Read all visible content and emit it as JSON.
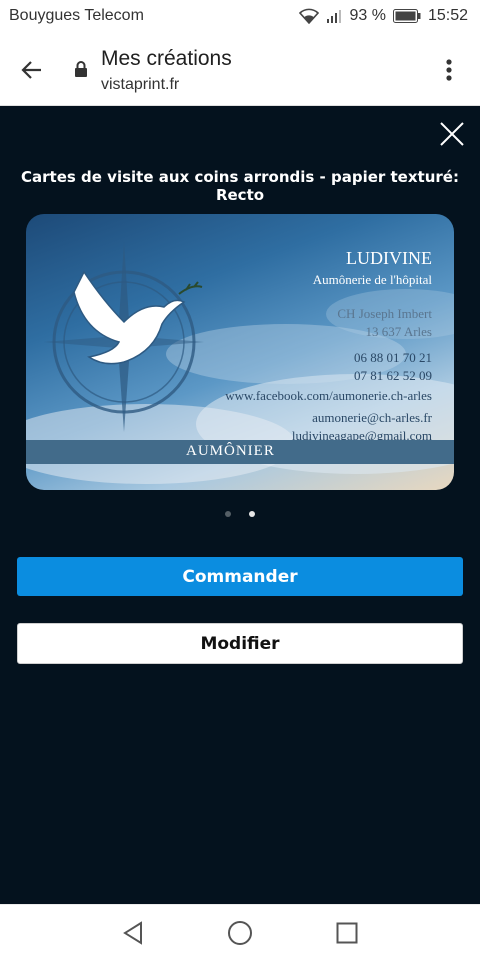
{
  "status_bar": {
    "carrier": "Bouygues Telecom",
    "battery": "93 %",
    "time": "15:52"
  },
  "browser": {
    "title": "Mes créations",
    "url": "vistaprint.fr"
  },
  "viewer": {
    "heading": "Cartes de visite aux coins arrondis - papier texturé: Recto",
    "card": {
      "name": "LUDIVINE",
      "subtitle": "Aumônerie de l'hôpital",
      "address_line1": "CH Joseph Imbert",
      "address_line2": "13 637 Arles",
      "phone1": "06 88 01 70 21",
      "phone2": "07 81 62 52 09",
      "website": "www.facebook.com/aumonerie.ch-arles",
      "email1": "aumonerie@ch-arles.fr",
      "email2": "ludivineagape@gmail.com",
      "band_label": "AUMÔNIER"
    },
    "pager": {
      "total": 2,
      "active": 2
    }
  },
  "actions": {
    "order_label": "Commander",
    "edit_label": "Modifier"
  },
  "colors": {
    "accent": "#0b8de0",
    "background": "#04121e",
    "card_band": "#426b8a"
  }
}
